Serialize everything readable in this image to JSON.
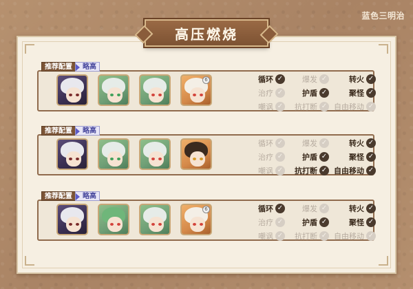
{
  "page": {
    "watermark": "蓝色三明治",
    "title": "高压燃烧"
  },
  "colors": {
    "background": "#b08d6d",
    "panel": "#f6efe2",
    "banner": "#8a5c3b",
    "role_on": "#4a3a2d",
    "role_off": "#d6cec4",
    "level_tag": "#5c5cc7"
  },
  "teams": [
    {
      "recommend_label": "推荐配置",
      "level_label": "略高",
      "characters": [
        {
          "icon": "silver-hair-character-icon",
          "theme": "purple"
        },
        {
          "icon": "white-hair-green-eyes-character-icon",
          "theme": "green"
        },
        {
          "icon": "white-hair-red-eyes-character-icon",
          "theme": "green"
        },
        {
          "icon": "white-hair-orange-bg-character-icon",
          "theme": "orange",
          "badge": "6"
        }
      ],
      "roles": [
        {
          "label": "循环",
          "active": true
        },
        {
          "label": "爆发",
          "active": false
        },
        {
          "label": "转火",
          "active": true
        },
        {
          "label": "治疗",
          "active": false
        },
        {
          "label": "护盾",
          "active": true
        },
        {
          "label": "聚怪",
          "active": true
        },
        {
          "label": "嘲讽",
          "active": false
        },
        {
          "label": "抗打断",
          "active": false
        },
        {
          "label": "自由移动",
          "active": false
        }
      ]
    },
    {
      "recommend_label": "推荐配置",
      "level_label": "略高",
      "characters": [
        {
          "icon": "silver-hair-character-icon",
          "theme": "purple"
        },
        {
          "icon": "white-hair-green-eyes-character-icon",
          "theme": "green"
        },
        {
          "icon": "white-hair-red-eyes-character-icon",
          "theme": "green"
        },
        {
          "icon": "dark-hair-amber-eyes-character-icon",
          "theme": "orange"
        }
      ],
      "roles": [
        {
          "label": "循环",
          "active": false
        },
        {
          "label": "爆发",
          "active": false
        },
        {
          "label": "转火",
          "active": true
        },
        {
          "label": "治疗",
          "active": false
        },
        {
          "label": "护盾",
          "active": true
        },
        {
          "label": "聚怪",
          "active": true
        },
        {
          "label": "嘲讽",
          "active": false
        },
        {
          "label": "抗打断",
          "active": true
        },
        {
          "label": "自由移动",
          "active": true
        }
      ]
    },
    {
      "recommend_label": "推荐配置",
      "level_label": "略高",
      "characters": [
        {
          "icon": "silver-hair-character-icon",
          "theme": "purple"
        },
        {
          "icon": "green-hair-glasses-character-icon",
          "theme": "green"
        },
        {
          "icon": "white-hair-red-eyes-character-icon",
          "theme": "green"
        },
        {
          "icon": "white-hair-orange-bg-character-icon",
          "theme": "orange",
          "badge": "6"
        }
      ],
      "roles": [
        {
          "label": "循环",
          "active": true
        },
        {
          "label": "爆发",
          "active": false
        },
        {
          "label": "转火",
          "active": true
        },
        {
          "label": "治疗",
          "active": false
        },
        {
          "label": "护盾",
          "active": true
        },
        {
          "label": "聚怪",
          "active": true
        },
        {
          "label": "嘲讽",
          "active": false
        },
        {
          "label": "抗打断",
          "active": false
        },
        {
          "label": "自由移动",
          "active": false
        }
      ]
    }
  ]
}
